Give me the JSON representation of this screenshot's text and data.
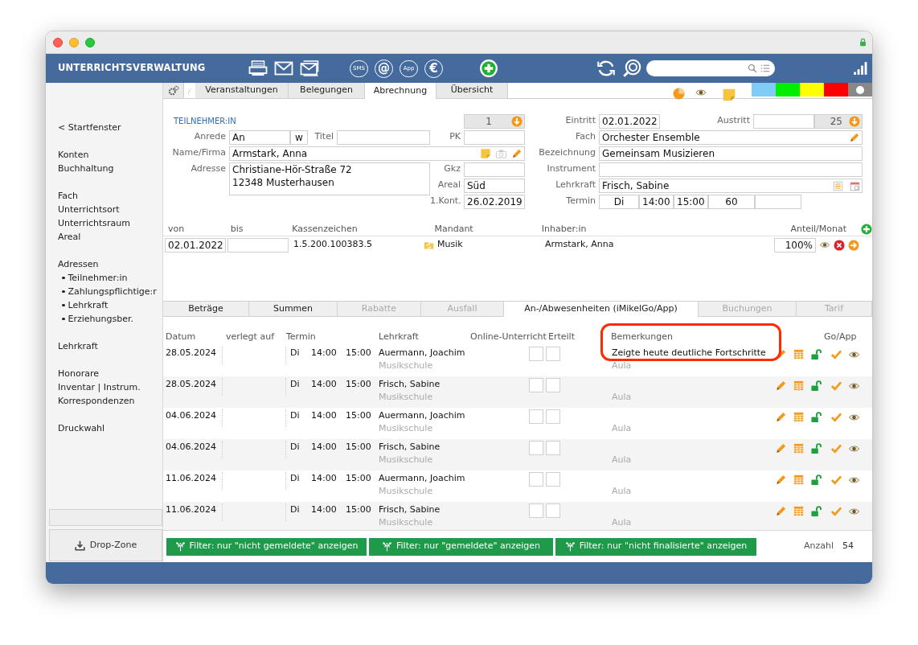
{
  "header": {
    "title": "UNTERRICHTSVERWALTUNG",
    "tool_groups": [
      [
        {
          "kind": "printer"
        },
        {
          "kind": "mail"
        },
        {
          "kind": "mails"
        }
      ],
      [
        {
          "kind": "bubble",
          "text": "SMS"
        },
        {
          "kind": "glyph",
          "text": "@"
        },
        {
          "kind": "bubble",
          "text": "App"
        },
        {
          "kind": "glyph",
          "text": "€"
        }
      ],
      [
        {
          "kind": "add"
        }
      ],
      [
        {
          "kind": "refresh"
        },
        {
          "kind": "search"
        }
      ]
    ]
  },
  "sidebar": {
    "groups": [
      [
        {
          "label": "< Startfenster"
        }
      ],
      [
        {
          "label": "Konten"
        },
        {
          "label": "Buchhaltung"
        }
      ],
      [
        {
          "label": "Fach"
        },
        {
          "label": "Unterrichtsort"
        },
        {
          "label": "Unterrichtsraum"
        },
        {
          "label": "Areal"
        }
      ],
      [
        {
          "label": "Adressen",
          "children": [
            {
              "label": "Teilnehmer:in"
            },
            {
              "label": "Zahlungspflichtige:r"
            },
            {
              "label": "Lehrkraft"
            },
            {
              "label": "Erziehungsber."
            }
          ]
        }
      ],
      [
        {
          "label": "Lehrkraft"
        }
      ],
      [
        {
          "label": "Honorare"
        },
        {
          "label": "Inventar | Instrum."
        },
        {
          "label": "Korrespondenzen"
        }
      ],
      [
        {
          "label": "Druckwahl"
        }
      ]
    ],
    "drop_zone": "Drop-Zone"
  },
  "tabs": [
    {
      "label": "Veranstaltungen",
      "selected": false
    },
    {
      "label": "Belegungen",
      "selected": false
    },
    {
      "label": "Abrechnung",
      "selected": true
    },
    {
      "label": "Übersicht",
      "selected": false
    }
  ],
  "color_swatches": [
    {
      "color": "#7fcdf7",
      "selected": false
    },
    {
      "color": "#00ee00",
      "selected": false
    },
    {
      "color": "#ffff00",
      "selected": false
    },
    {
      "color": "#ff0000",
      "selected": false
    },
    {
      "color": "#888888",
      "selected": true
    }
  ],
  "participant": {
    "section_label": "TEILNEHMER:IN",
    "number": "1",
    "anrede": {
      "label": "Anrede",
      "value": "An",
      "gender": "w"
    },
    "titel": {
      "label": "Titel"
    },
    "pk": {
      "label": "PK"
    },
    "name": {
      "label": "Name/Firma",
      "value": "Armstark, Anna"
    },
    "adresse": {
      "label": "Adresse",
      "lines": [
        "Christiane-Hör-Straße 72",
        "12348 Musterhausen"
      ]
    },
    "gkz": {
      "label": "Gkz"
    },
    "areal": {
      "label": "Areal",
      "value": "Süd"
    },
    "kont": {
      "label": "1.Kont.",
      "value": "26.02.2019"
    }
  },
  "course": {
    "eintritt": {
      "label": "Eintritt",
      "value": "02.01.2022"
    },
    "austritt": {
      "label": "Austritt",
      "number": "25"
    },
    "fach": {
      "label": "Fach",
      "value": "Orchester Ensemble"
    },
    "bezeichnung": {
      "label": "Bezeichnung",
      "value": "Gemeinsam Musizieren"
    },
    "instrument": {
      "label": "Instrument"
    },
    "lehrkraft": {
      "label": "Lehrkraft",
      "value": "Frisch, Sabine"
    },
    "termin": {
      "label": "Termin",
      "values": [
        "Di",
        "14:00",
        "15:00",
        "60"
      ]
    }
  },
  "mandant_table": {
    "columns": [
      "von",
      "bis",
      "Kassenzeichen",
      "Mandant",
      "Inhaber:in",
      "Anteil/Monat"
    ],
    "rows": [
      {
        "von": "02.01.2022",
        "bis": "",
        "kassenzeichen": "1.5.200.100383.5",
        "mandant": "Musik",
        "inhaber": "Armstark, Anna",
        "anteil": "100%"
      }
    ]
  },
  "sub_tabs": [
    {
      "label": "Beträge",
      "selected": false,
      "disabled": false
    },
    {
      "label": "Summen",
      "selected": false,
      "disabled": false
    },
    {
      "label": "Rabatte",
      "selected": false,
      "disabled": true
    },
    {
      "label": "Ausfall",
      "selected": false,
      "disabled": true
    },
    {
      "label": "An-/Abwesenheiten (iMikelGo/App)",
      "selected": true,
      "disabled": false
    },
    {
      "label": "Buchungen",
      "selected": false,
      "disabled": true
    },
    {
      "label": "Tarif",
      "selected": false,
      "disabled": true
    }
  ],
  "attendance": {
    "columns": [
      "Datum",
      "verlegt auf",
      "Termin",
      "Lehrkraft",
      "Online-Unterricht",
      "Erteilt",
      "Bemerkungen",
      "Go/App"
    ],
    "rows": [
      {
        "date": "28.05.2024",
        "day": "Di",
        "start": "14:00",
        "end": "15:00",
        "teacher": "Auermann, Joachim",
        "place": "Musikschule",
        "online": false,
        "given": false,
        "remark": "Zeigte heute deutliche Fortschritte",
        "room": "Aula"
      },
      {
        "date": "28.05.2024",
        "day": "Di",
        "start": "14:00",
        "end": "15:00",
        "teacher": "Frisch, Sabine",
        "place": "Musikschule",
        "online": false,
        "given": false,
        "remark": "",
        "room": "Aula"
      },
      {
        "date": "04.06.2024",
        "day": "Di",
        "start": "14:00",
        "end": "15:00",
        "teacher": "Auermann, Joachim",
        "place": "Musikschule",
        "online": false,
        "given": false,
        "remark": "",
        "room": "Aula"
      },
      {
        "date": "04.06.2024",
        "day": "Di",
        "start": "14:00",
        "end": "15:00",
        "teacher": "Frisch, Sabine",
        "place": "Musikschule",
        "online": false,
        "given": false,
        "remark": "",
        "room": "Aula"
      },
      {
        "date": "11.06.2024",
        "day": "Di",
        "start": "14:00",
        "end": "15:00",
        "teacher": "Auermann, Joachim",
        "place": "Musikschule",
        "online": false,
        "given": false,
        "remark": "",
        "room": "Aula"
      },
      {
        "date": "11.06.2024",
        "day": "Di",
        "start": "14:00",
        "end": "15:00",
        "teacher": "Frisch, Sabine",
        "place": "Musikschule",
        "online": false,
        "given": false,
        "remark": "",
        "room": "Aula"
      }
    ]
  },
  "filters": [
    "Filter: nur \"nicht gemeldete\" anzeigen",
    "Filter: nur \"gemeldete\" anzeigen",
    "Filter: nur \"nicht finalisierte\" anzeigen"
  ],
  "count": {
    "label": "Anzahl",
    "value": "54"
  }
}
